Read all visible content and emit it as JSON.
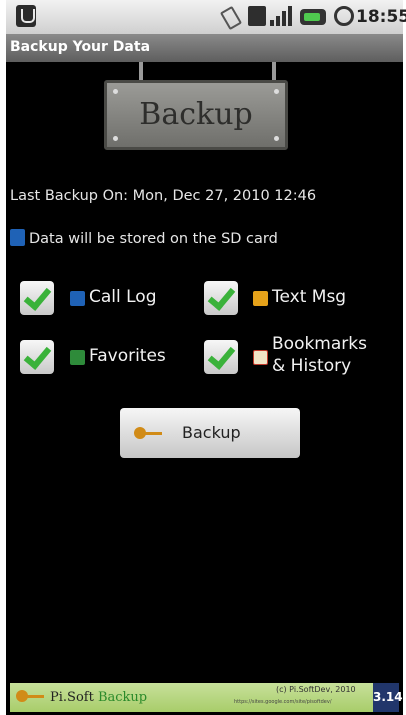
{
  "status_bar": {
    "time": "18:55"
  },
  "title_bar": {
    "title": "Backup Your Data"
  },
  "sign": {
    "label": "Backup"
  },
  "info": {
    "last_backup": "Last Backup On: Mon, Dec 27, 2010 12:46",
    "storage_note": "Data will be stored on the SD card"
  },
  "options": [
    {
      "label": "Call Log",
      "checked": true,
      "icon": "phone-icon",
      "color": "#1f62b6"
    },
    {
      "label": "Text Msg",
      "checked": true,
      "icon": "envelope-icon",
      "color": "#e5a21a"
    },
    {
      "label": "Favorites",
      "checked": true,
      "icon": "contact-icon",
      "color": "#2e8b3a"
    },
    {
      "label": "Bookmarks & History",
      "label_line1": "Bookmarks",
      "label_line2": "& History",
      "checked": true,
      "icon": "star-icon",
      "color": "#c0392b"
    }
  ],
  "actions": {
    "backup_label": "Backup"
  },
  "footer": {
    "brand_prefix": "Pi.Soft",
    "brand_suffix": "Backup",
    "copyright": "(c) Pi.SoftDev, 2010",
    "url": "https://sites.google.com/site/pisoftdev/",
    "version": "3.14"
  }
}
